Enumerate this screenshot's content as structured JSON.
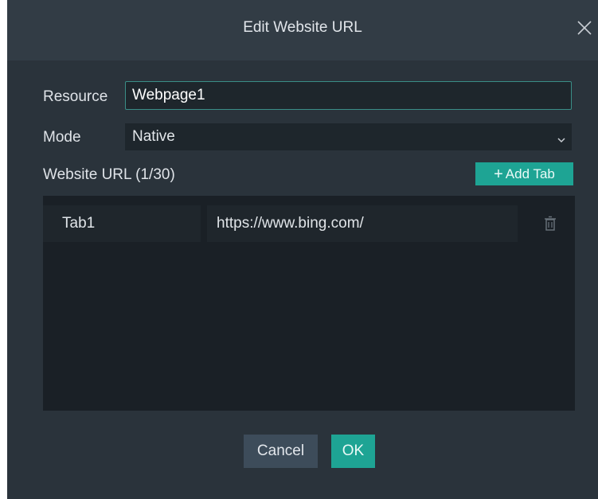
{
  "dialog": {
    "title": "Edit Website URL",
    "close_icon": "close-icon"
  },
  "form": {
    "resource_label": "Resource",
    "resource_value": "Webpage1",
    "mode_label": "Mode",
    "mode_value": "Native",
    "website_url_label": "Website URL",
    "website_url_count": "(1/30)",
    "add_tab_label": "Add Tab"
  },
  "tabs": [
    {
      "name": "Tab1",
      "url": "https://www.bing.com/",
      "delete_icon": "trash-icon"
    }
  ],
  "footer": {
    "cancel_label": "Cancel",
    "ok_label": "OK"
  },
  "colors": {
    "accent": "#1ea494",
    "dialog_bg": "#2a333b",
    "titlebar_bg": "#323c45",
    "panel_bg": "#1a2026",
    "cancel_bg": "#3d4c5a"
  }
}
